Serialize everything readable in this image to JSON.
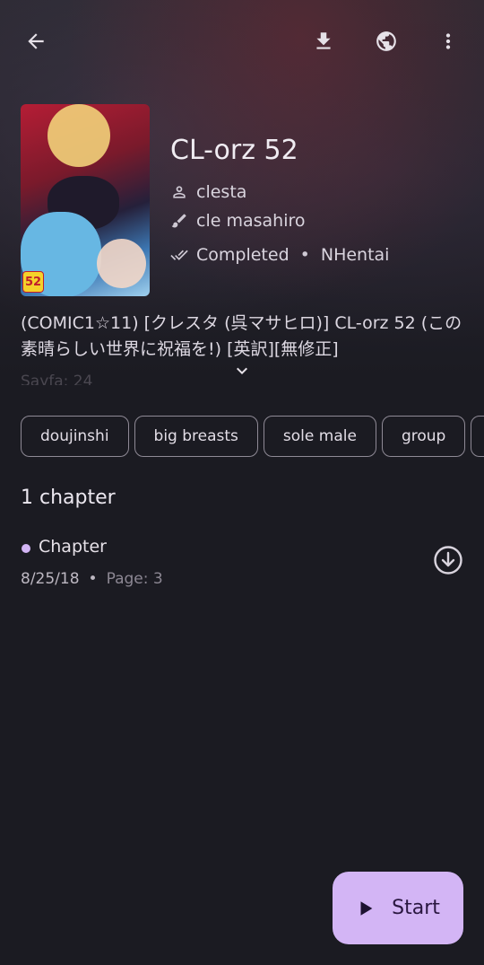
{
  "toolbar": {
    "back_icon": "arrow-back-icon",
    "download_icon": "download-icon",
    "webview_icon": "globe-icon",
    "more_icon": "more-vert-icon"
  },
  "manga": {
    "cover_badge": "52",
    "title": "CL-orz 52",
    "author": "clesta",
    "artist": "cle masahiro",
    "status": "Completed",
    "source": "NHentai",
    "description": "(COMIC1☆11) [クレスタ (呉マサヒロ)] CL-orz 52 (この素晴らしい世界に祝福を!) [英訳][無修正]",
    "description_fade": "Sayfa: 24",
    "tags": [
      "doujinshi",
      "big breasts",
      "sole male",
      "group",
      ""
    ]
  },
  "chapters": {
    "count_label": "1 chapter",
    "items": [
      {
        "name": "Chapter",
        "date": "8/25/18",
        "page": "Page: 3"
      }
    ]
  },
  "fab": {
    "label": "Start"
  },
  "colors": {
    "accent": "#d3b5f5",
    "background": "#1b1b22"
  }
}
